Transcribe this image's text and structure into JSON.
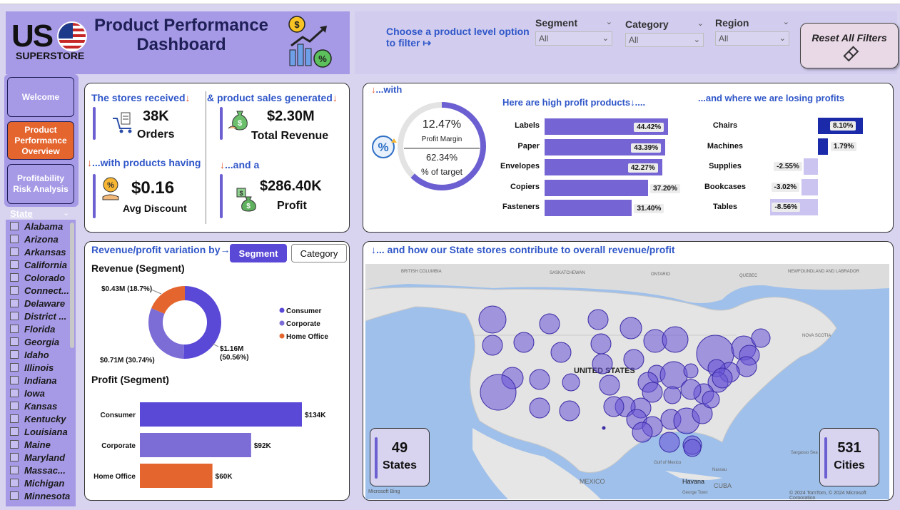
{
  "header": {
    "logo_us": "US",
    "logo_sub": "SUPERSTORE",
    "title": "Product Performance Dashboard",
    "choose_text": "Choose a product level option to filter ↦"
  },
  "filters": [
    {
      "label": "Segment",
      "value": "All"
    },
    {
      "label": "Category",
      "value": "All"
    },
    {
      "label": "Region",
      "value": "All"
    }
  ],
  "reset_label": "Reset All Filters",
  "nav": [
    {
      "label": "Welcome",
      "active": false
    },
    {
      "label": "Product Performance Overview",
      "active": true
    },
    {
      "label": "Profitability Risk Analysis",
      "active": false
    }
  ],
  "state_slicer": {
    "label": "State",
    "items": [
      "Alabama",
      "Arizona",
      "Arkansas",
      "California",
      "Colorado",
      "Connect...",
      "Delaware",
      "District ...",
      "Florida",
      "Georgia",
      "Idaho",
      "Illinois",
      "Indiana",
      "Iowa",
      "Kansas",
      "Kentucky",
      "Louisiana",
      "Maine",
      "Maryland",
      "Massac...",
      "Michigan",
      "Minnesota"
    ]
  },
  "kpis": {
    "orders_head": "The stores received",
    "orders_value": "38K",
    "orders_label": "Orders",
    "revenue_head": "& product sales generated",
    "revenue_value": "$2.30M",
    "revenue_label": "Total Revenue",
    "discount_head": "...with products having",
    "discount_value": "$0.16",
    "discount_label": "Avg Discount",
    "profit_head": "...and a",
    "profit_value": "$286.40K",
    "profit_label": "Profit"
  },
  "margin": {
    "head": "...with",
    "value": "12.47%",
    "value_label": "Profit Margin",
    "target": "62.34%",
    "target_label": "% of target",
    "target_fraction": 0.6234
  },
  "high_profit": {
    "head": "Here are high profit products↓....",
    "items": [
      {
        "label": "Labels",
        "value": 44.42,
        "text": "44.42%"
      },
      {
        "label": "Paper",
        "value": 43.39,
        "text": "43.39%"
      },
      {
        "label": "Envelopes",
        "value": 42.27,
        "text": "42.27%"
      },
      {
        "label": "Copiers",
        "value": 37.2,
        "text": "37.20%"
      },
      {
        "label": "Fasteners",
        "value": 31.4,
        "text": "31.40%"
      }
    ]
  },
  "losing_profit": {
    "head": "...and where we are losing profits",
    "items": [
      {
        "label": "Chairs",
        "value": 8.1,
        "text": "8.10%",
        "color": "#1a2aa8"
      },
      {
        "label": "Machines",
        "value": 1.79,
        "text": "1.79%",
        "color": "#1a2aa8"
      },
      {
        "label": "Supplies",
        "value": -2.55,
        "text": "-2.55%",
        "color": "#cbc3f0"
      },
      {
        "label": "Bookcases",
        "value": -3.02,
        "text": "-3.02%",
        "color": "#cbc3f0"
      },
      {
        "label": "Tables",
        "value": -8.56,
        "text": "-8.56%",
        "color": "#cbc3f0"
      }
    ]
  },
  "variation": {
    "head": "Revenue/profit variation by→",
    "btn_segment": "Segment",
    "btn_category": "Category"
  },
  "chart_data": [
    {
      "type": "pie",
      "title": "Revenue (Segment)",
      "categories": [
        "Consumer",
        "Corporate",
        "Home Office"
      ],
      "values": [
        1.16,
        0.71,
        0.43
      ],
      "labels": [
        "$1.16M (50.56%)",
        "$0.71M (30.74%)",
        "$0.43M (18.7%)"
      ],
      "colors": [
        "#5a48d6",
        "#7b6cd6",
        "#e4652e"
      ],
      "legend": "right"
    },
    {
      "type": "bar",
      "title": "Profit (Segment)",
      "categories": [
        "Consumer",
        "Corporate",
        "Home Office"
      ],
      "values": [
        134,
        92,
        60
      ],
      "labels": [
        "$134K",
        "$92K",
        "$60K"
      ],
      "colors": [
        "#5a48d6",
        "#7b6cd6",
        "#e4652e"
      ]
    }
  ],
  "map_section": {
    "head": "↓... and how our State stores contribute to overall revenue/profit",
    "states_value": "49",
    "states_label": "States",
    "cities_value": "531",
    "cities_label": "Cities",
    "center_label": "UNITED STATES",
    "place_labels": [
      "BRITISH COLUMBIA",
      "SASKATCHEWAN",
      "ONTARIO",
      "QUEBEC",
      "NEWFOUNDLAND AND LABRADOR",
      "NOVA SCOTIA",
      "MEXICO",
      "CUBA",
      "Havana",
      "Gulf of Mexico",
      "Nassau",
      "Sargasso Sea",
      "George Town"
    ],
    "credit": "© 2024 TomTom, © 2024 Microsoft Corporation",
    "bing": "Microsoft Bing"
  },
  "colors": {
    "accent": "#6b5fd2",
    "heading": "#2f56c8",
    "arrow": "#e4572e",
    "panel": "#a69ae6"
  }
}
